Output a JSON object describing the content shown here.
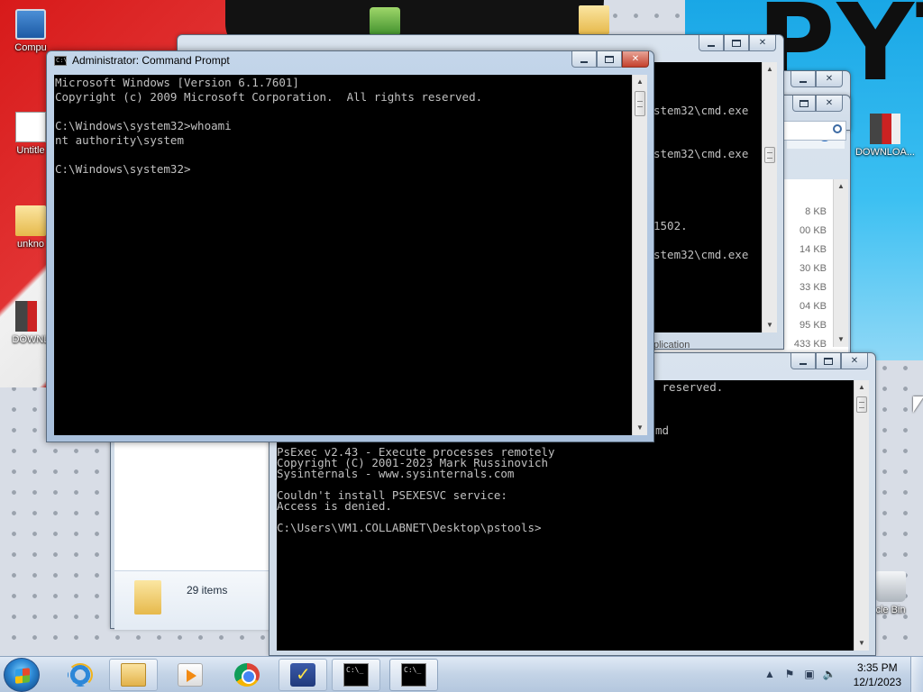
{
  "desktop": {
    "icons": [
      {
        "label": "Compu",
        "icon": "computer-icon"
      },
      {
        "label": "Untitle",
        "icon": "document-icon"
      },
      {
        "label": "unkno",
        "icon": "folder-icon"
      },
      {
        "label": "DOWNL",
        "icon": "download-image-icon"
      },
      {
        "label": "DOWNLOA...",
        "icon": "download-image-icon"
      },
      {
        "label": "cle Bin",
        "icon": "recycle-bin-icon"
      }
    ],
    "wallpaper_text": "PYT"
  },
  "windows": {
    "main_cmd": {
      "title": "Administrator: Command Prompt",
      "icon": "cmd-icon",
      "lines": [
        "Microsoft Windows [Version 6.1.7601]",
        "Copyright (c) 2009 Microsoft Corporation.  All rights reserved.",
        "",
        "C:\\Windows\\system32>whoami",
        "nt authority\\system",
        "",
        "C:\\Windows\\system32>"
      ]
    },
    "back_cmd_1": {
      "lines": [
        "stem32\\cmd.exe",
        "",
        "",
        "stem32\\cmd.exe",
        "",
        "",
        "",
        "",
        "1502.",
        "",
        "stem32\\cmd.exe"
      ],
      "status_fragment": "plication"
    },
    "explorer": {
      "sizes": [
        "8 KB",
        "00 KB",
        "14 KB",
        "30 KB",
        "33 KB",
        "04 KB",
        "95 KB",
        "433 KB"
      ],
      "status_items": "29 items",
      "help_icon": "help-icon",
      "search_icon": "search-icon"
    },
    "psexec_cmd": {
      "partial_lines": [
        " reserved.",
        "",
        "",
        "md"
      ],
      "lines": [
        "PsExec v2.43 - Execute processes remotely",
        "Copyright (C) 2001-2023 Mark Russinovich",
        "Sysinternals - www.sysinternals.com",
        "",
        "Couldn't install PSEXESVC service:",
        "Access is denied.",
        "",
        "C:\\Users\\VM1.COLLABNET\\Desktop\\pstools>"
      ]
    }
  },
  "taskbar": {
    "start_label": "Start",
    "pinned": [
      {
        "name": "internet-explorer",
        "icon": "ie-icon"
      },
      {
        "name": "windows-explorer",
        "icon": "folder-icon"
      },
      {
        "name": "media-player",
        "icon": "media-player-icon"
      },
      {
        "name": "chrome",
        "icon": "chrome-icon"
      },
      {
        "name": "notepad-plus",
        "icon": "notepad-plus-icon"
      },
      {
        "name": "cmd-1",
        "icon": "cmd-icon"
      },
      {
        "name": "cmd-2",
        "icon": "cmd-icon"
      }
    ],
    "clock": {
      "time": "3:35 PM",
      "date": "12/1/2023"
    },
    "tray_icons": [
      "show-hidden-icons-icon",
      "action-center-icon",
      "network-icon",
      "volume-muted-icon"
    ]
  },
  "colors": {
    "console_bg": "#000000",
    "console_fg": "#c0c0c0",
    "close_button": "#c4402c",
    "taskbar": "#c3d3e6"
  }
}
